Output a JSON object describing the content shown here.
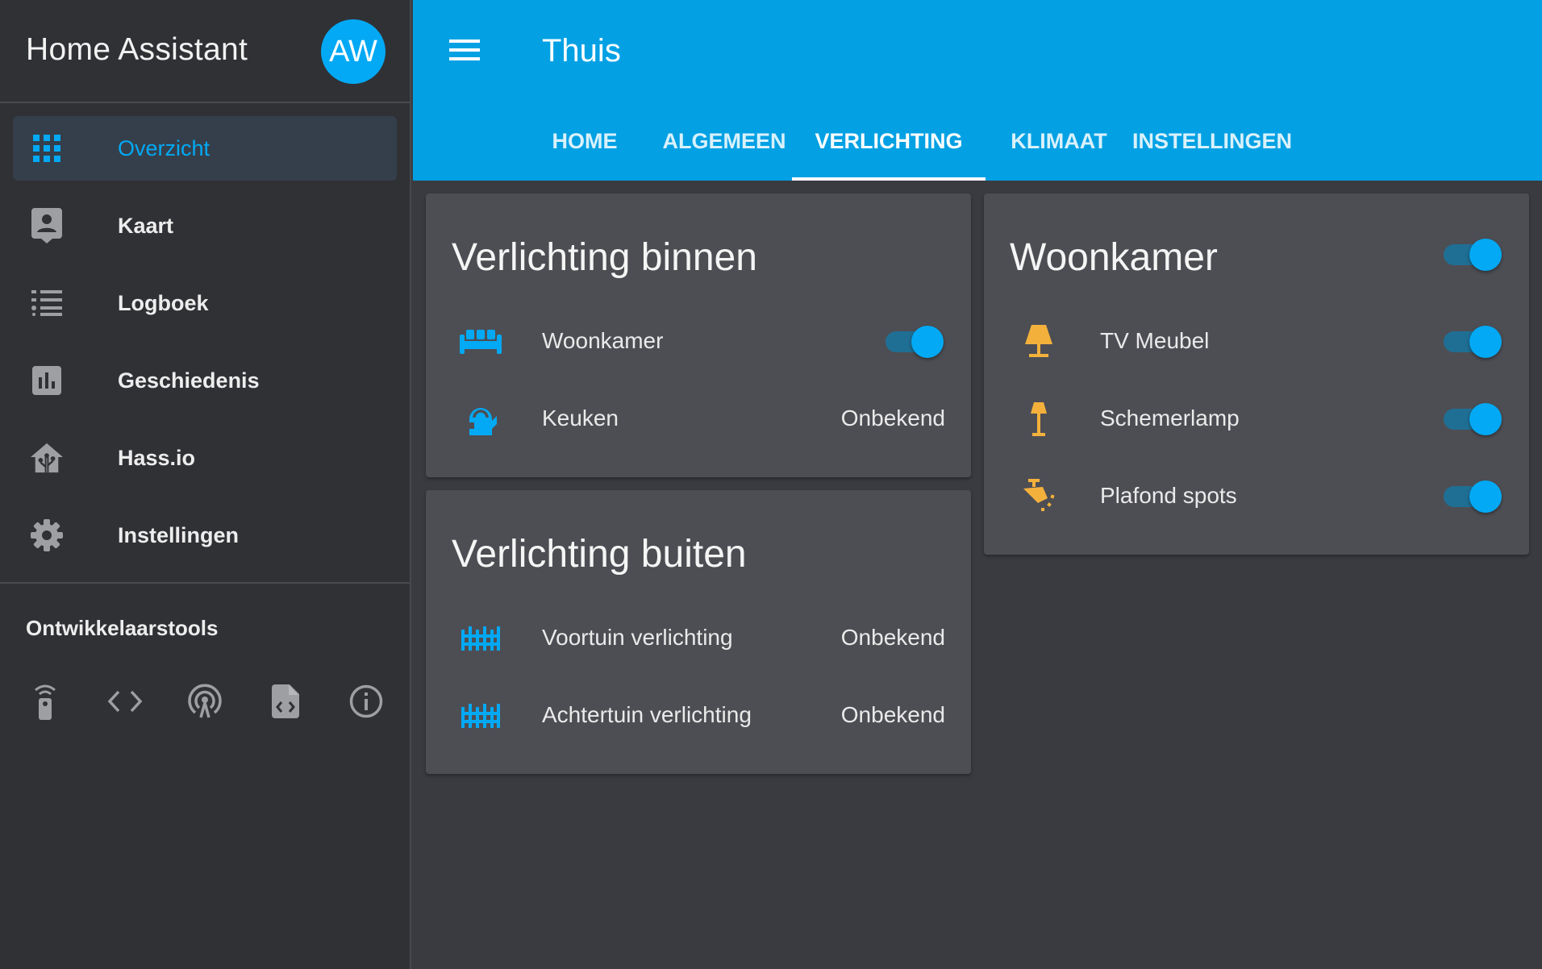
{
  "sidebar": {
    "app_title": "Home Assistant",
    "avatar_initials": "AW",
    "items": [
      {
        "label": "Overzicht",
        "icon": "apps-grid-icon",
        "active": true
      },
      {
        "label": "Kaart",
        "icon": "account-box-icon",
        "active": false
      },
      {
        "label": "Logboek",
        "icon": "format-list-icon",
        "active": false
      },
      {
        "label": "Geschiedenis",
        "icon": "chart-bar-icon",
        "active": false
      },
      {
        "label": "Hass.io",
        "icon": "home-assistant-icon",
        "active": false
      },
      {
        "label": "Instellingen",
        "icon": "gear-icon",
        "active": false
      }
    ],
    "devtools": {
      "title": "Ontwikkelaarstools",
      "icons": [
        "remote-icon",
        "code-brackets-icon",
        "podcast-icon",
        "file-code-icon",
        "info-icon"
      ]
    }
  },
  "toolbar": {
    "title": "Thuis",
    "tabs": [
      {
        "label": "HOME",
        "active": false
      },
      {
        "label": "ALGEMEEN",
        "active": false
      },
      {
        "label": "VERLICHTING",
        "active": true
      },
      {
        "label": "KLIMAAT",
        "active": false
      },
      {
        "label": "INSTELLINGEN",
        "active": false
      }
    ]
  },
  "cards": {
    "binnen": {
      "title": "Verlichting binnen",
      "rows": [
        {
          "label": "Woonkamer",
          "icon": "sofa-icon",
          "toggle": true
        },
        {
          "label": "Keuken",
          "icon": "kettle-icon",
          "state": "Onbekend"
        }
      ]
    },
    "buiten": {
      "title": "Verlichting buiten",
      "rows": [
        {
          "label": "Voortuin verlichting",
          "icon": "fence-icon",
          "state": "Onbekend"
        },
        {
          "label": "Achtertuin verlichting",
          "icon": "fence-icon",
          "state": "Onbekend"
        }
      ]
    },
    "woonkamer": {
      "title": "Woonkamer",
      "header_toggle": true,
      "rows": [
        {
          "label": "TV Meubel",
          "icon": "lamp-icon",
          "toggle": true
        },
        {
          "label": "Schemerlamp",
          "icon": "floor-lamp-icon",
          "toggle": true
        },
        {
          "label": "Plafond spots",
          "icon": "ceiling-spot-icon",
          "toggle": true
        }
      ]
    }
  },
  "colors": {
    "accent": "#03a9f4",
    "toolbar": "#03a1e4",
    "sidebar_bg": "#303135",
    "card_bg": "#4d4e54",
    "page_bg": "#3a3b40",
    "lamp_on": "#f3b13c"
  }
}
